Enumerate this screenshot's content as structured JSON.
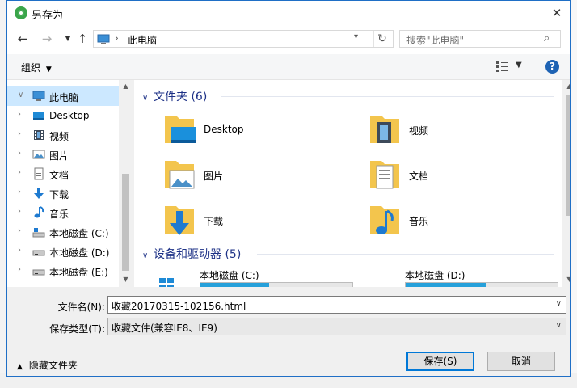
{
  "dialog": {
    "title": "另存为",
    "close_icon": "close-icon"
  },
  "navigation": {
    "back_icon": "arrow-left-icon",
    "forward_icon": "arrow-right-icon",
    "recent_icon": "chevron-down-icon",
    "up_icon": "arrow-up-icon",
    "address_path": "此电脑",
    "refresh_icon": "refresh-icon",
    "search_placeholder": "搜索\"此电脑\""
  },
  "toolbar": {
    "organize_label": "组织",
    "view_icon": "view-options-icon",
    "help_label": "?"
  },
  "sidebar": {
    "items": [
      {
        "label": "此电脑",
        "icon": "computer-icon",
        "selected": true,
        "expanded": true
      },
      {
        "label": "Desktop",
        "icon": "desktop-folder-icon"
      },
      {
        "label": "视频",
        "icon": "video-icon"
      },
      {
        "label": "图片",
        "icon": "picture-icon"
      },
      {
        "label": "文档",
        "icon": "document-icon"
      },
      {
        "label": "下载",
        "icon": "download-icon"
      },
      {
        "label": "音乐",
        "icon": "music-icon"
      },
      {
        "label": "本地磁盘 (C:)",
        "icon": "system-drive-icon"
      },
      {
        "label": "本地磁盘 (D:)",
        "icon": "drive-icon"
      },
      {
        "label": "本地磁盘 (E:)",
        "icon": "drive-icon"
      }
    ]
  },
  "content": {
    "folders_group": "文件夹 (6)",
    "folders": [
      {
        "label": "Desktop",
        "icon": "desktop-folder-icon"
      },
      {
        "label": "视频",
        "icon": "video-folder-icon"
      },
      {
        "label": "图片",
        "icon": "pictures-folder-icon"
      },
      {
        "label": "文档",
        "icon": "documents-folder-icon"
      },
      {
        "label": "下载",
        "icon": "downloads-folder-icon"
      },
      {
        "label": "音乐",
        "icon": "music-folder-icon"
      }
    ],
    "devices_group": "设备和驱动器 (5)",
    "drives": [
      {
        "label": "本地磁盘 (C:)",
        "used_fraction": 0.45,
        "icon": "windows-drive-icon"
      },
      {
        "label": "本地磁盘 (D:)",
        "used_fraction": 0.53,
        "icon": "drive-icon"
      }
    ]
  },
  "form": {
    "filename_label": "文件名(N):",
    "filename_value": "收藏20170315-102156.html",
    "filetype_label": "保存类型(T):",
    "filetype_value": "收藏文件(兼容IE8、IE9)"
  },
  "footer": {
    "hide_folders_label": "隐藏文件夹",
    "save_label": "保存(S)",
    "cancel_label": "取消"
  },
  "colors": {
    "accent": "#0078d7",
    "selection": "#cce8ff",
    "group_header": "#1e3287",
    "drive_fill": "#26a0da"
  }
}
